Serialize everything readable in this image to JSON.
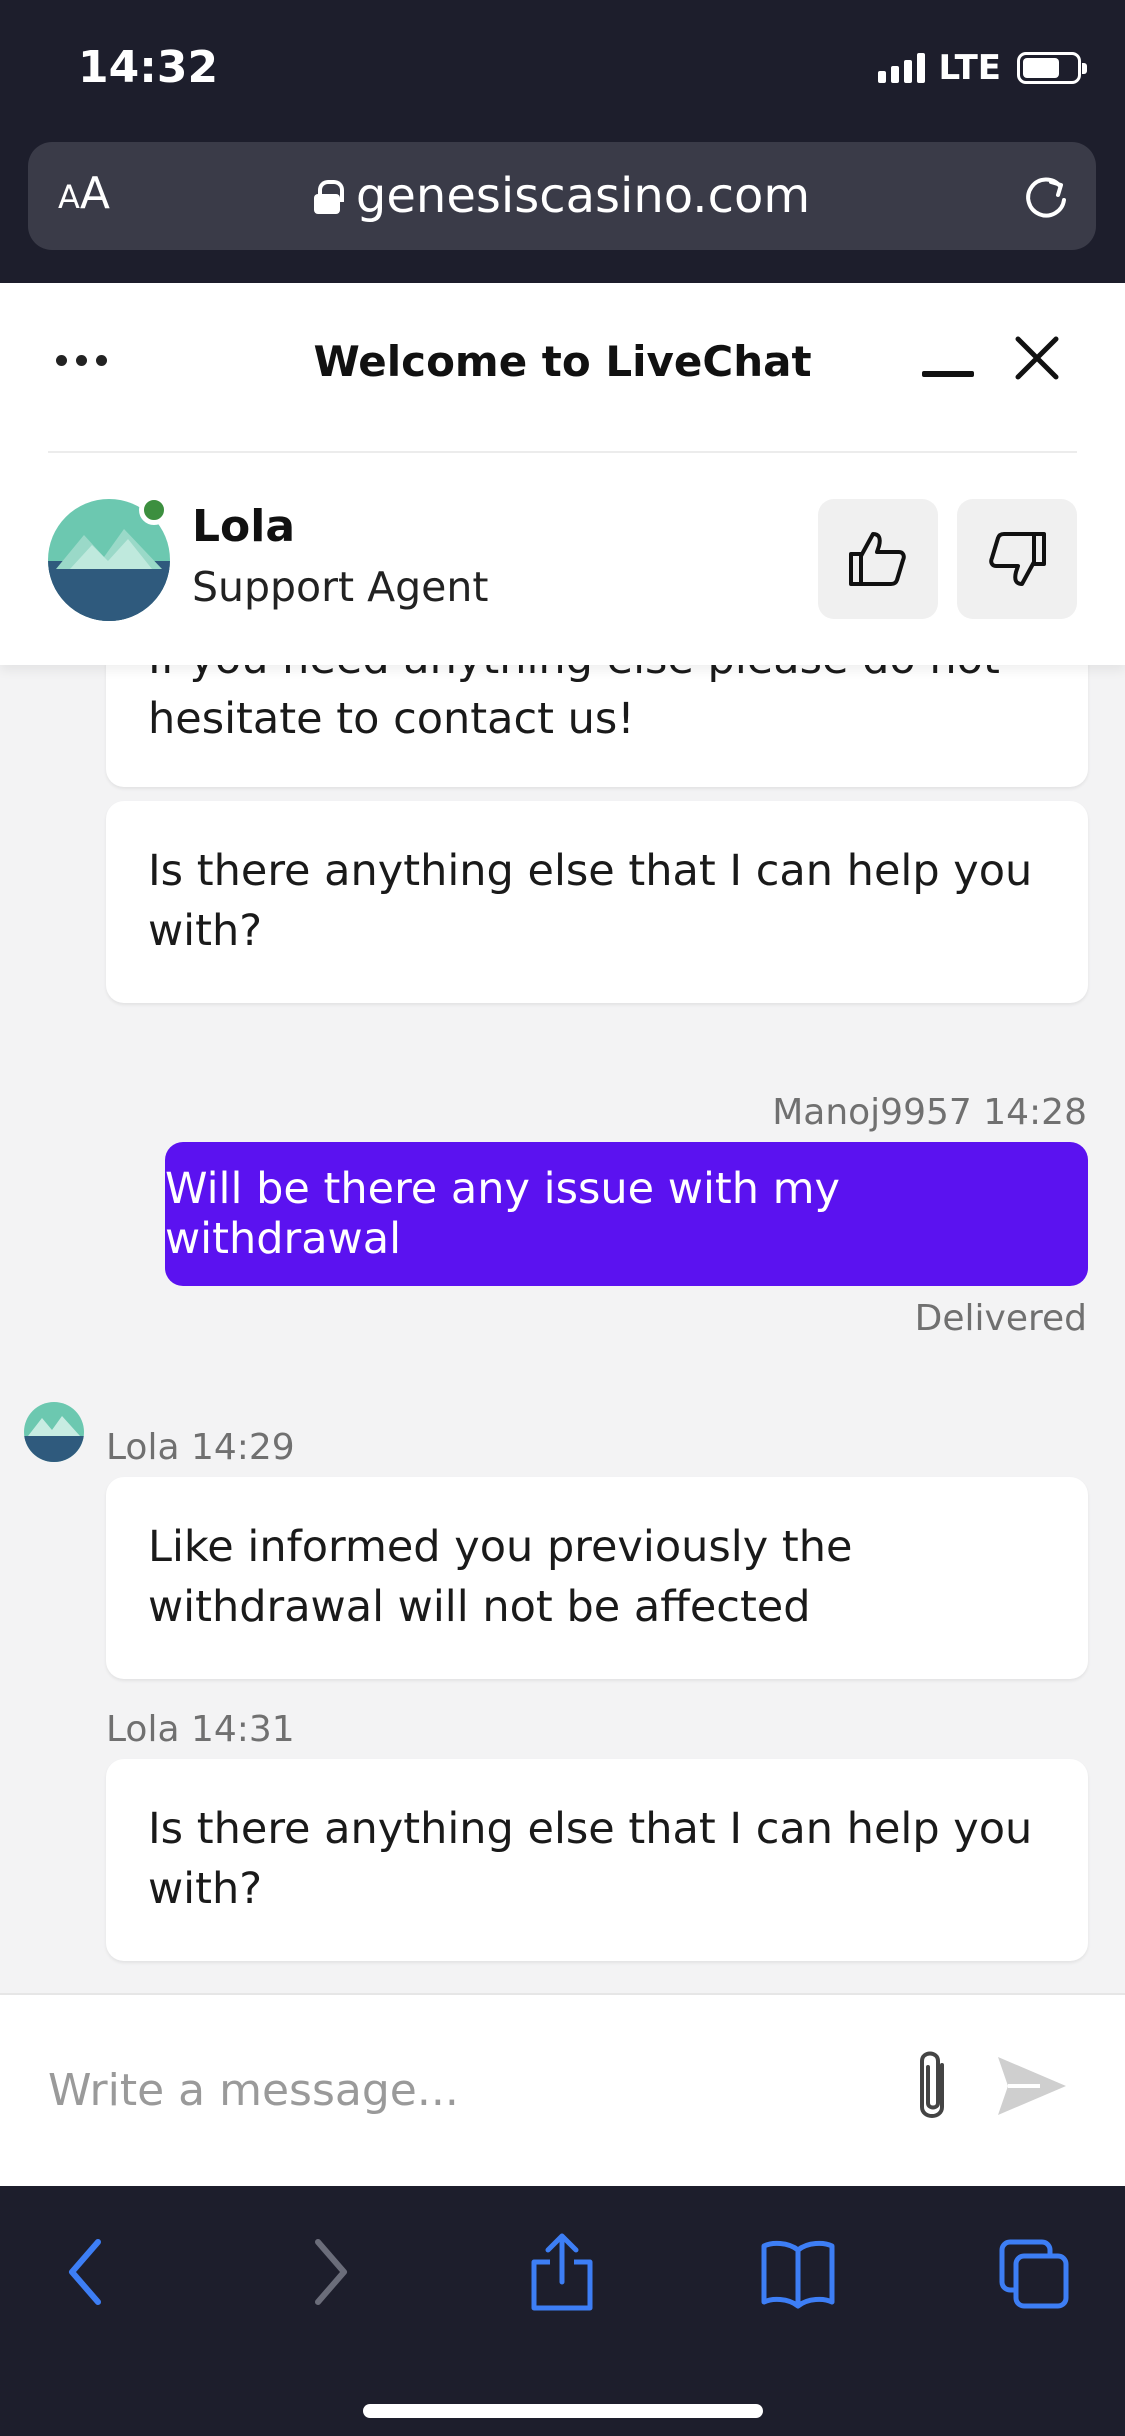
{
  "status_bar": {
    "time": "14:32",
    "network": "LTE"
  },
  "browser": {
    "text_size_label_small": "A",
    "text_size_label_large": "A",
    "url": "genesiscasino.com"
  },
  "chat_header": {
    "title": "Welcome to LiveChat"
  },
  "agent": {
    "name": "Lola",
    "role": "Support Agent"
  },
  "messages": [
    {
      "text_cut": "If you need anything else please do not",
      "text": "hesitate to contact us!"
    },
    {
      "text": "Is there anything else that I can help you with?"
    },
    {
      "meta": "Manoj9957 14:28",
      "text": "Will be there any issue with my withdrawal",
      "status": "Delivered"
    },
    {
      "meta": "Lola 14:29",
      "text": "Like informed you previously the withdrawal will not be affected"
    },
    {
      "meta": "Lola 14:31",
      "text": "Is there anything else that I can help you with?"
    }
  ],
  "composer": {
    "placeholder": "Write a message..."
  },
  "colors": {
    "accent": "#5b12f0",
    "chrome": "#1d1e2c",
    "toolbar_icon": "#3d7ef5",
    "online": "#3c8f3f"
  }
}
